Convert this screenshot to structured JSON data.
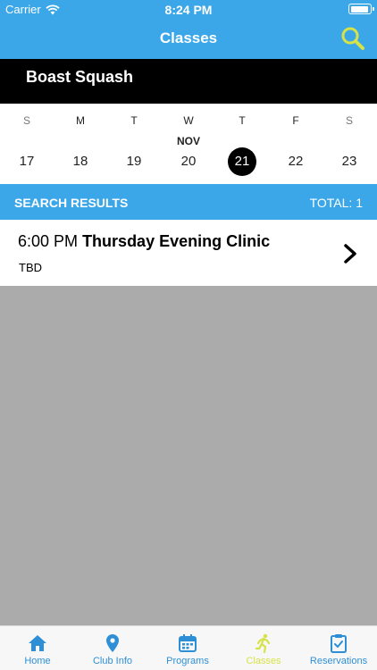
{
  "status_bar": {
    "carrier": "Carrier",
    "time": "8:24 PM"
  },
  "nav": {
    "title": "Classes"
  },
  "club": {
    "name": "Boast Squash"
  },
  "calendar": {
    "month": "NOV",
    "days": [
      {
        "letter": "S",
        "number": "17"
      },
      {
        "letter": "M",
        "number": "18"
      },
      {
        "letter": "T",
        "number": "19"
      },
      {
        "letter": "W",
        "number": "20"
      },
      {
        "letter": "T",
        "number": "21"
      },
      {
        "letter": "F",
        "number": "22"
      },
      {
        "letter": "S",
        "number": "23"
      }
    ],
    "selected_number": "21"
  },
  "results": {
    "label": "SEARCH RESULTS",
    "total": "TOTAL: 1"
  },
  "classes": [
    {
      "time": "6:00 PM",
      "name": "Thursday Evening Clinic",
      "location": "TBD"
    }
  ],
  "tabs": [
    {
      "label": "Home",
      "icon": "home-icon"
    },
    {
      "label": "Club Info",
      "icon": "location-pin-icon"
    },
    {
      "label": "Programs",
      "icon": "calendar-icon"
    },
    {
      "label": "Classes",
      "icon": "runner-icon"
    },
    {
      "label": "Reservations",
      "icon": "clipboard-check-icon"
    }
  ],
  "colors": {
    "header": "#3ba7e8",
    "accent": "#d6e24a",
    "tab_inactive": "#2e8fd6",
    "content_bg": "#ababab"
  }
}
